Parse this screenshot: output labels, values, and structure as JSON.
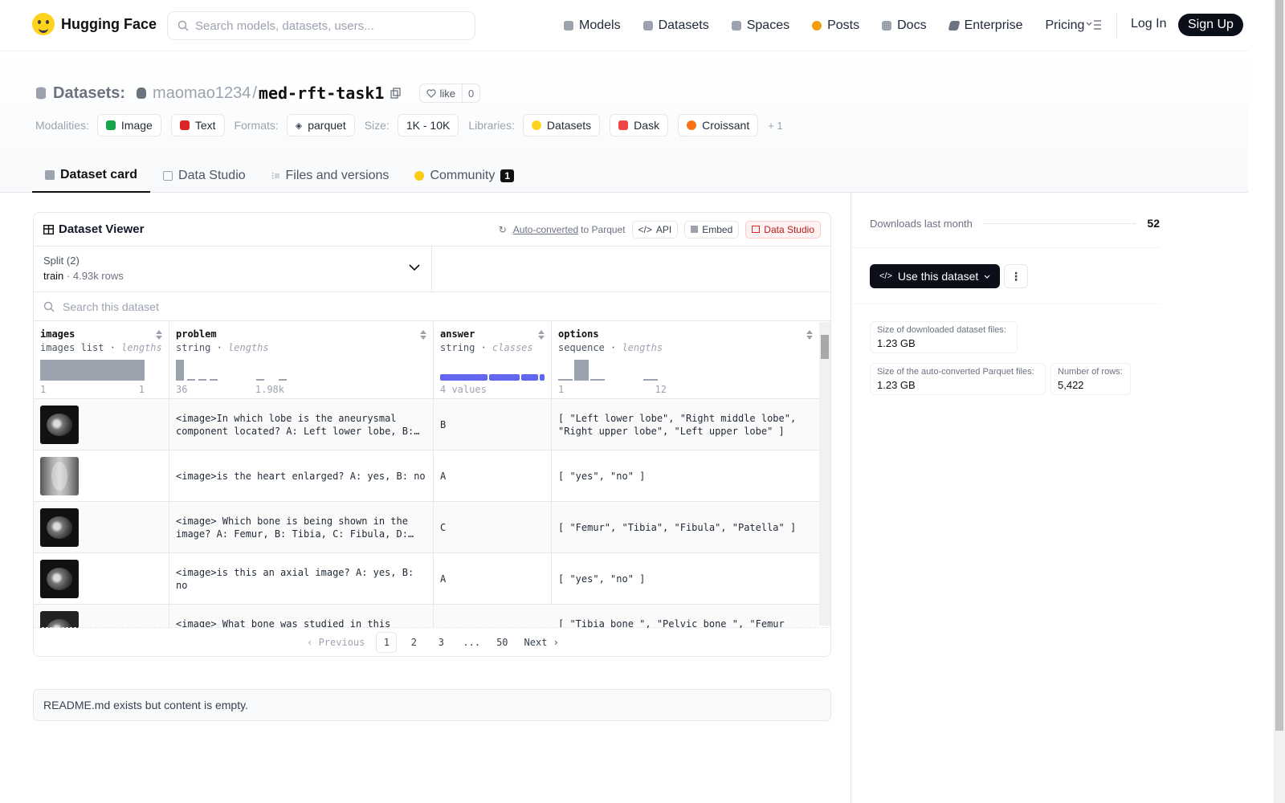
{
  "nav": {
    "brand": "Hugging Face",
    "search_placeholder": "Search models, datasets, users...",
    "links": [
      {
        "label": "Models",
        "icon": "cube-icon",
        "color": "#9ca3af"
      },
      {
        "label": "Datasets",
        "icon": "database-icon",
        "color": "#9ca3af"
      },
      {
        "label": "Spaces",
        "icon": "grid-icon",
        "color": "#9ca3af"
      },
      {
        "label": "Posts",
        "icon": "posts-icon",
        "color": "#f59e0b"
      },
      {
        "label": "Docs",
        "icon": "book-icon",
        "color": "#9ca3af"
      },
      {
        "label": "Enterprise",
        "icon": "enterprise-icon",
        "color": "#6b7280"
      },
      {
        "label": "Pricing",
        "icon": "",
        "color": ""
      }
    ],
    "login": "Log In",
    "signup": "Sign Up"
  },
  "header": {
    "datasets_label": "Datasets:",
    "owner": "maomao1234",
    "separator": "/",
    "repo": "med-rft-task1",
    "like_label": "like",
    "like_count": "0",
    "modalities_label": "Modalities:",
    "modalities": [
      {
        "label": "Image",
        "color": "#16a34a"
      },
      {
        "label": "Text",
        "color": "#dc2626"
      }
    ],
    "formats_label": "Formats:",
    "format": "parquet",
    "size_label": "Size:",
    "size": "1K - 10K",
    "libraries_label": "Libraries:",
    "libraries": [
      {
        "label": "Datasets",
        "color": "#ffd21e"
      },
      {
        "label": "Dask",
        "color": "#ef4444"
      },
      {
        "label": "Croissant",
        "color": "#f97316"
      }
    ],
    "libraries_more": "+ 1"
  },
  "tabs": [
    {
      "label": "Dataset card",
      "active": true
    },
    {
      "label": "Data Studio",
      "active": false
    },
    {
      "label": "Files and versions",
      "active": false
    },
    {
      "label": "Community",
      "active": false,
      "badge": "1"
    }
  ],
  "viewer": {
    "title": "Dataset Viewer",
    "auto_converted": "Auto-converted",
    "to_parquet": "to Parquet",
    "api": "API",
    "embed": "Embed",
    "data_studio": "Data Studio",
    "split_label": "Split (2)",
    "split_name": "train",
    "split_rows": "4.93k rows",
    "search_placeholder": "Search this dataset",
    "columns": [
      {
        "name": "images",
        "type": "images list",
        "stat": "lengths",
        "min": "1",
        "max": "1"
      },
      {
        "name": "problem",
        "type": "string",
        "stat": "lengths",
        "min": "36",
        "max": "1.98k"
      },
      {
        "name": "answer",
        "type": "string",
        "stat": "classes",
        "min": "4 values",
        "max": ""
      },
      {
        "name": "options",
        "type": "sequence",
        "stat": "lengths",
        "min": "1",
        "max": "12"
      }
    ],
    "rows": [
      {
        "problem": "<image>In which lobe is the aneurysmal component located? A: Left lower lobe, B: Right middle lobe, C: Right upper lobe, D: Left upper lobe",
        "answer": "B",
        "options": "[ \"Left lower lobe\", \"Right middle lobe\", \"Right upper lobe\", \"Left upper lobe\" ]"
      },
      {
        "problem": "<image>is the heart enlarged? A: yes, B: no",
        "answer": "A",
        "options": "[ \"yes\", \"no\" ]"
      },
      {
        "problem": "<image> Which bone is being shown in the image? A: Femur, B: Tibia, C: Fibula, D: Patella",
        "answer": "C",
        "options": "[ \"Femur\", \"Tibia\", \"Fibula\", \"Patella\" ]"
      },
      {
        "problem": "<image>is this an axial image? A: yes, B: no",
        "answer": "A",
        "options": "[ \"yes\", \"no\" ]"
      },
      {
        "problem": "<image> What bone was studied in this",
        "answer": "",
        "options": "[ \"Tibia bone \", \"Pelvic bone \", \"Femur"
      }
    ],
    "pager": {
      "prev": "Previous",
      "pages": [
        "1",
        "2",
        "3",
        "...",
        "50"
      ],
      "next": "Next"
    }
  },
  "readme": "README.md exists but content is empty.",
  "sidebar": {
    "downloads_label": "Downloads last month",
    "downloads": "52",
    "use_button": "Use this dataset",
    "stats": [
      {
        "label": "Size of downloaded dataset files:",
        "value": "1.23 GB"
      },
      {
        "label": "Size of the auto-converted Parquet files:",
        "value": "1.23 GB"
      },
      {
        "label": "Number of rows:",
        "value": "5,422"
      }
    ]
  }
}
